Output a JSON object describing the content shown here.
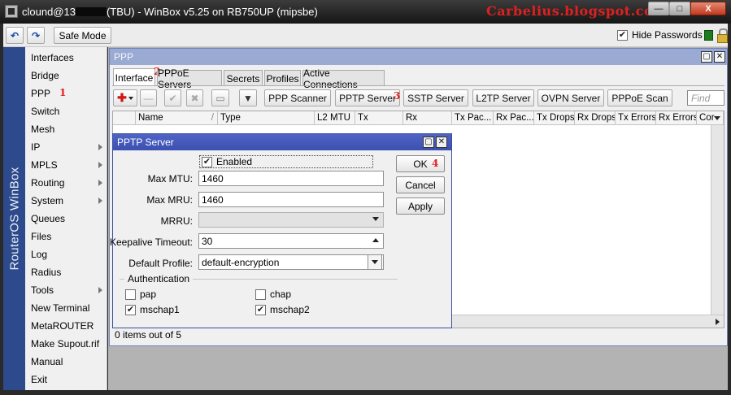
{
  "window": {
    "title_prefix": "clound@13",
    "title_suffix": "(TBU) - WinBox v5.25 on RB750UP (mipsbe)",
    "watermark": "Carbelius.blogspot.com",
    "minimize": "—",
    "maximize": "□",
    "close": "X"
  },
  "toolbar": {
    "undo_icon": "↶",
    "redo_icon": "↷",
    "safe_mode_label": "Safe Mode",
    "hide_passwords_label": "Hide Passwords",
    "hide_passwords_checked": true
  },
  "brand": "RouterOS WinBox",
  "sidebar": {
    "items": [
      {
        "label": "Interfaces",
        "submenu": false
      },
      {
        "label": "Bridge",
        "submenu": false
      },
      {
        "label": "PPP",
        "submenu": false,
        "note": "1"
      },
      {
        "label": "Switch",
        "submenu": false
      },
      {
        "label": "Mesh",
        "submenu": false
      },
      {
        "label": "IP",
        "submenu": true
      },
      {
        "label": "MPLS",
        "submenu": true
      },
      {
        "label": "Routing",
        "submenu": true
      },
      {
        "label": "System",
        "submenu": true
      },
      {
        "label": "Queues",
        "submenu": false
      },
      {
        "label": "Files",
        "submenu": false
      },
      {
        "label": "Log",
        "submenu": false
      },
      {
        "label": "Radius",
        "submenu": false
      },
      {
        "label": "Tools",
        "submenu": true
      },
      {
        "label": "New Terminal",
        "submenu": false
      },
      {
        "label": "MetaROUTER",
        "submenu": false
      },
      {
        "label": "Make Supout.rif",
        "submenu": false
      },
      {
        "label": "Manual",
        "submenu": false
      },
      {
        "label": "Exit",
        "submenu": false
      }
    ]
  },
  "ppp_window": {
    "title": "PPP",
    "tabs": [
      {
        "label": "Interface",
        "note": "2",
        "active": true
      },
      {
        "label": "PPPoE Servers"
      },
      {
        "label": "Secrets"
      },
      {
        "label": "Profiles"
      },
      {
        "label": "Active Connections"
      }
    ],
    "buttons": {
      "add": "✚",
      "remove": "—",
      "enable": "✔",
      "disable": "✖",
      "comment": "▭",
      "filter": "▼",
      "ppp_scanner": "PPP Scanner",
      "pptp_server": "PPTP Server",
      "pptp_note": "3",
      "sstp_server": "SSTP Server",
      "l2tp_server": "L2TP Server",
      "ovpn_server": "OVPN Server",
      "pppoe_scan": "PPPoE Scan"
    },
    "find_placeholder": "Find",
    "columns": [
      "",
      "Name",
      "Type",
      "L2 MTU",
      "Tx",
      "Rx",
      "Tx Pac...",
      "Rx Pac...",
      "Tx Drops",
      "Rx Drops",
      "Tx Errors",
      "Rx Errors",
      "Cor"
    ],
    "status": "0 items out of 5"
  },
  "pptp_dialog": {
    "title": "PPTP Server",
    "enabled_label": "Enabled",
    "enabled": true,
    "max_mtu_label": "Max MTU:",
    "max_mtu": "1460",
    "max_mru_label": "Max MRU:",
    "max_mru": "1460",
    "mrru_label": "MRRU:",
    "mrru": "",
    "keepalive_label": "Keepalive Timeout:",
    "keepalive": "30",
    "default_profile_label": "Default Profile:",
    "default_profile": "default-encryption",
    "auth_label": "Authentication",
    "auth": {
      "pap": {
        "label": "pap",
        "checked": false
      },
      "chap": {
        "label": "chap",
        "checked": false
      },
      "mschap1": {
        "label": "mschap1",
        "checked": true
      },
      "mschap2": {
        "label": "mschap2",
        "checked": true
      }
    },
    "ok_label": "OK",
    "ok_note": "4",
    "cancel_label": "Cancel",
    "apply_label": "Apply"
  },
  "colors": {
    "annotation": "#e02020",
    "dialog_caption": "#3f53b6",
    "ppp_caption": "#9aaad2",
    "brand_strip": "#2d4a8c"
  }
}
